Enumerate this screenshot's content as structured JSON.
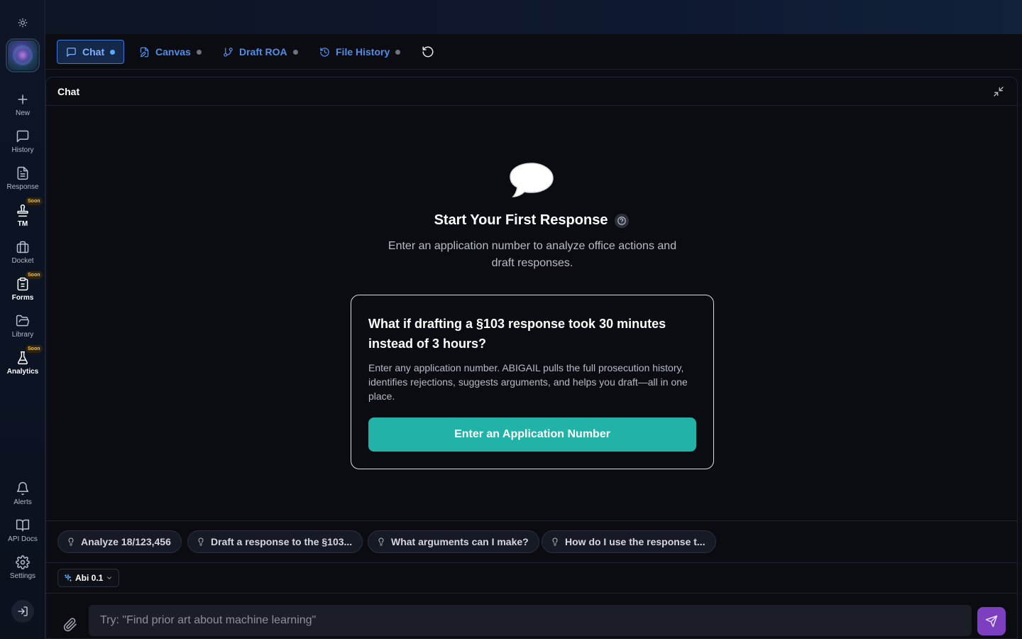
{
  "sidebar": {
    "items": [
      {
        "label": "New",
        "icon": "plus-icon"
      },
      {
        "label": "History",
        "icon": "message-square-icon"
      },
      {
        "label": "Response",
        "icon": "file-text-icon"
      },
      {
        "label": "TM",
        "icon": "stamp-icon",
        "badge": "Soon"
      },
      {
        "label": "Docket",
        "icon": "briefcase-icon"
      },
      {
        "label": "Forms",
        "icon": "clipboard-icon",
        "badge": "Soon"
      },
      {
        "label": "Library",
        "icon": "folder-open-icon"
      },
      {
        "label": "Analytics",
        "icon": "flask-icon",
        "badge": "Soon"
      }
    ],
    "bottom_items": [
      {
        "label": "Alerts",
        "icon": "bell-icon"
      },
      {
        "label": "API Docs",
        "icon": "book-open-icon"
      },
      {
        "label": "Settings",
        "icon": "gear-icon"
      }
    ]
  },
  "tabs": [
    {
      "label": "Chat",
      "icon": "message-square-icon",
      "active": true
    },
    {
      "label": "Canvas",
      "icon": "file-edit-icon",
      "active": false
    },
    {
      "label": "Draft ROA",
      "icon": "git-branch-icon",
      "active": false
    },
    {
      "label": "File History",
      "icon": "history-icon",
      "active": false
    }
  ],
  "panel": {
    "title": "Chat"
  },
  "hero": {
    "title": "Start Your First Response",
    "subtitle": "Enter an application number to analyze office actions and draft responses."
  },
  "card": {
    "title": "What if drafting a §103 response took 30 minutes instead of 3 hours?",
    "body": "Enter any application number. ABIGAIL pulls the full prosecution history, identifies rejections, suggests arguments, and helps you draft—all in one place.",
    "button": "Enter an Application Number"
  },
  "suggestions": [
    "Analyze 18/123,456",
    "Draft a response to the §103...",
    "What arguments can I make?",
    "How do I use the response t..."
  ],
  "model": {
    "label": "Abi 0.1"
  },
  "input": {
    "placeholder": "Try: \"Find prior art about machine learning\""
  },
  "colors": {
    "accent_teal": "#21b3a8",
    "send_purple": "#7b3fc0",
    "tab_blue": "#4f8ee8",
    "soon_badge": "#f0c15a"
  }
}
